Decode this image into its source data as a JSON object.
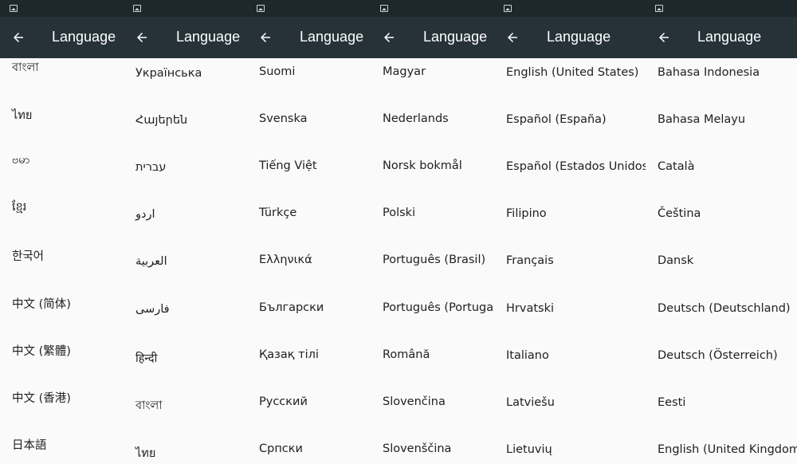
{
  "toolbar": {
    "title": "Language"
  },
  "icons": {
    "back": "arrow-back-icon",
    "status": "image-icon"
  },
  "colors": {
    "statusbar": "#1e272b",
    "toolbar": "#263238",
    "title": "#ffffff",
    "background": "#fafafa",
    "text": "#212121"
  },
  "screens": [
    {
      "items": [
        "বাংলা",
        "ไทย",
        "ဗမာ",
        "ខ្មែរ",
        "한국어",
        "中文 (简体)",
        "中文 (繁體)",
        "中文 (香港)",
        "日本語"
      ]
    },
    {
      "items": [
        "Українська",
        "Հայերեն",
        "עברית",
        "اردو",
        "العربية",
        "فارسی",
        "हिन्दी",
        "বাংলা",
        "ไทย"
      ]
    },
    {
      "items": [
        "Suomi",
        "Svenska",
        "Tiếng Việt",
        "Türkçe",
        "Ελληνικά",
        "Български",
        "Қазақ тілі",
        "Русский",
        "Српски"
      ]
    },
    {
      "items": [
        "Magyar",
        "Nederlands",
        "Norsk bokmål",
        "Polski",
        "Português (Brasil)",
        "Português (Portugal)",
        "Română",
        "Slovenčina",
        "Slovenščina"
      ]
    },
    {
      "items": [
        "English (United States)",
        "Español (España)",
        "Español (Estados Unidos)",
        "Filipino",
        "Français",
        "Hrvatski",
        "Italiano",
        "Latviešu",
        "Lietuvių"
      ]
    },
    {
      "items": [
        "Bahasa Indonesia",
        "Bahasa Melayu",
        "Català",
        "Čeština",
        "Dansk",
        "Deutsch (Deutschland)",
        "Deutsch (Österreich)",
        "Eesti",
        "English (United Kingdom)"
      ]
    }
  ]
}
